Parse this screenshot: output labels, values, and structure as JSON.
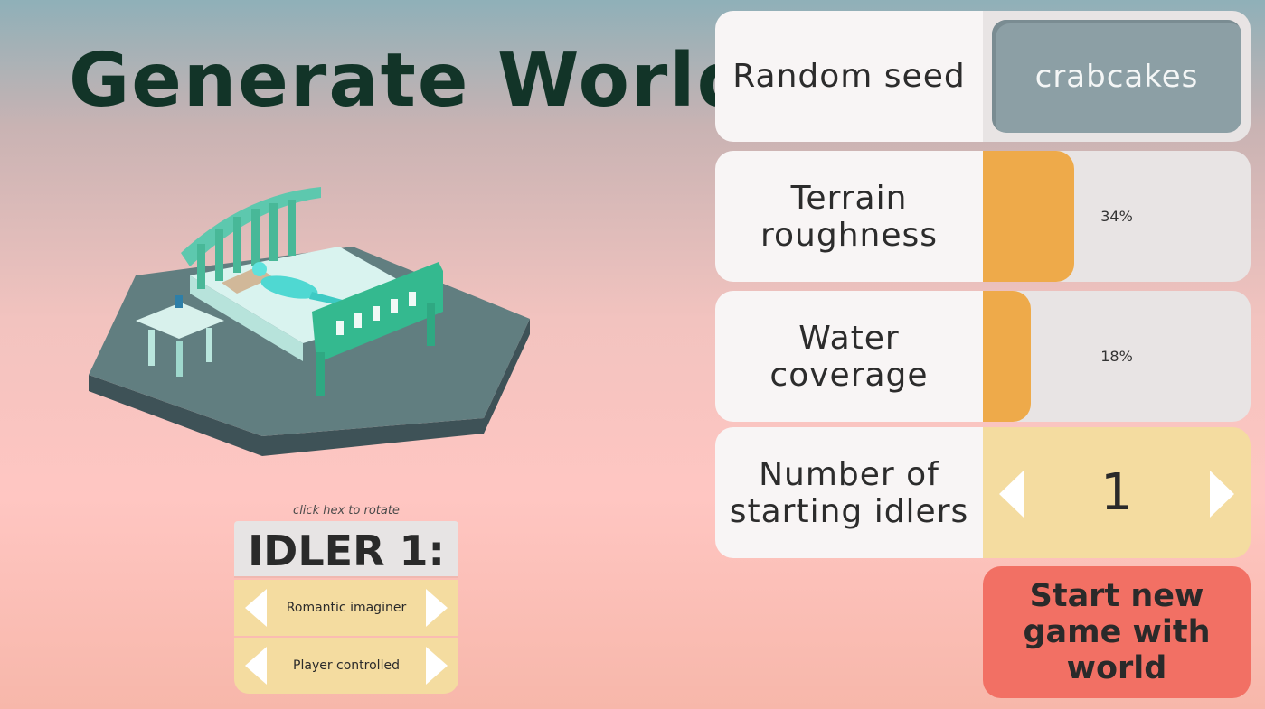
{
  "title": "Generate World",
  "hint": "click hex to rotate",
  "idler": {
    "header": "IDLER 1:",
    "personality": "Romantic imaginer",
    "control": "Player controlled"
  },
  "settings": {
    "seed": {
      "label": "Random seed",
      "value": "crabcakes"
    },
    "terrain": {
      "label": "Terrain roughness",
      "value": 0.34,
      "text": "34%"
    },
    "water": {
      "label": "Water coverage",
      "value": 0.18,
      "text": "18%"
    },
    "idlers": {
      "label": "Number of starting idlers",
      "value": "1"
    }
  },
  "start_button": "Start new game with world",
  "colors": {
    "accent": "#eeaa4a",
    "start": "#f27064",
    "selector": "#f4dca0",
    "title": "#123428"
  }
}
